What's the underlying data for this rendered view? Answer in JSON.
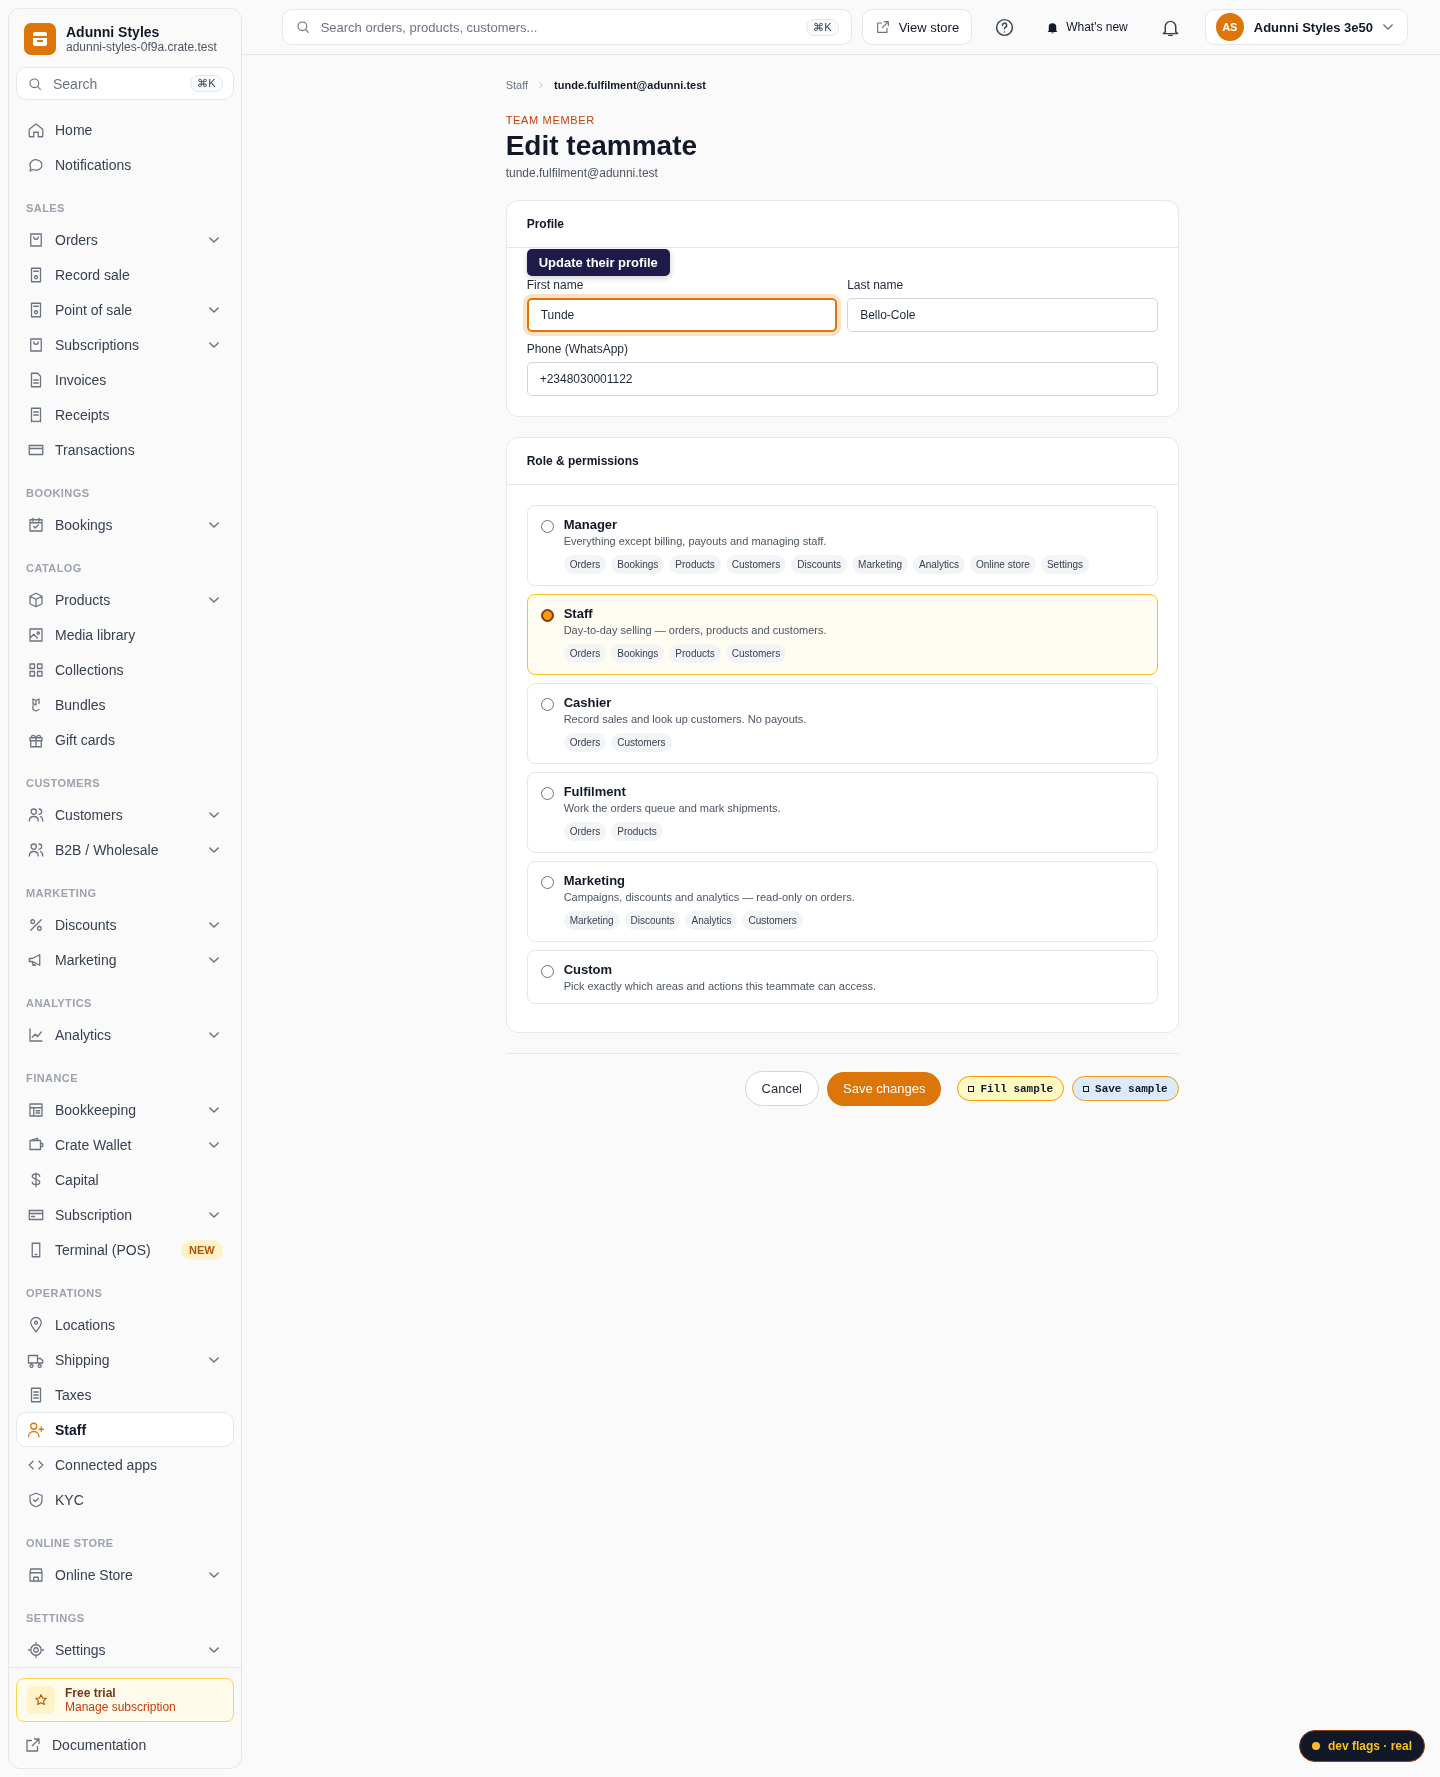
{
  "brand": {
    "name": "Adunni Styles",
    "domain": "adunni-styles-0f9a.crate.test"
  },
  "sidebar_search": {
    "placeholder": "Search",
    "shortcut": "⌘K"
  },
  "sidebar": {
    "sections": [
      {
        "items": [
          {
            "label": "Home",
            "expandable": false,
            "selected": false
          },
          {
            "label": "Notifications",
            "expandable": false,
            "selected": false
          }
        ]
      },
      {
        "title": "SALES",
        "items": [
          {
            "label": "Orders",
            "expandable": true,
            "selected": false
          },
          {
            "label": "Record sale",
            "expandable": false,
            "selected": false
          },
          {
            "label": "Point of sale",
            "expandable": true,
            "selected": false
          },
          {
            "label": "Subscriptions",
            "expandable": true,
            "selected": false
          },
          {
            "label": "Invoices",
            "expandable": false,
            "selected": false
          },
          {
            "label": "Receipts",
            "expandable": false,
            "selected": false
          },
          {
            "label": "Transactions",
            "expandable": false,
            "selected": false
          }
        ]
      },
      {
        "title": "BOOKINGS",
        "items": [
          {
            "label": "Bookings",
            "expandable": true,
            "selected": false
          }
        ]
      },
      {
        "title": "CATALOG",
        "items": [
          {
            "label": "Products",
            "expandable": true,
            "selected": false
          },
          {
            "label": "Media library",
            "expandable": false,
            "selected": false
          },
          {
            "label": "Collections",
            "expandable": false,
            "selected": false
          },
          {
            "label": "Bundles",
            "expandable": false,
            "selected": false
          },
          {
            "label": "Gift cards",
            "expandable": false,
            "selected": false
          }
        ]
      },
      {
        "title": "CUSTOMERS",
        "items": [
          {
            "label": "Customers",
            "expandable": true,
            "selected": false
          },
          {
            "label": "B2B / Wholesale",
            "expandable": true,
            "selected": false
          }
        ]
      },
      {
        "title": "MARKETING",
        "items": [
          {
            "label": "Discounts",
            "expandable": true,
            "selected": false
          },
          {
            "label": "Marketing",
            "expandable": true,
            "selected": false
          }
        ]
      },
      {
        "title": "ANALYTICS",
        "items": [
          {
            "label": "Analytics",
            "expandable": true,
            "selected": false
          }
        ]
      },
      {
        "title": "FINANCE",
        "items": [
          {
            "label": "Bookkeeping",
            "expandable": true,
            "selected": false
          },
          {
            "label": "Crate Wallet",
            "expandable": true,
            "selected": false
          },
          {
            "label": "Capital",
            "expandable": false,
            "selected": false
          },
          {
            "label": "Subscription",
            "expandable": true,
            "selected": false
          },
          {
            "label": "Terminal (POS)",
            "expandable": false,
            "selected": false,
            "badge": "NEW"
          }
        ]
      },
      {
        "title": "OPERATIONS",
        "items": [
          {
            "label": "Locations",
            "expandable": false,
            "selected": false
          },
          {
            "label": "Shipping",
            "expandable": true,
            "selected": false
          },
          {
            "label": "Taxes",
            "expandable": false,
            "selected": false
          },
          {
            "label": "Staff",
            "expandable": false,
            "selected": true
          },
          {
            "label": "Connected apps",
            "expandable": false,
            "selected": false
          },
          {
            "label": "KYC",
            "expandable": false,
            "selected": false
          }
        ]
      },
      {
        "title": "ONLINE STORE",
        "items": [
          {
            "label": "Online Store",
            "expandable": true,
            "selected": false
          }
        ]
      },
      {
        "title": "SETTINGS",
        "items": [
          {
            "label": "Settings",
            "expandable": true,
            "selected": false
          }
        ]
      }
    ]
  },
  "trial": {
    "title": "Free trial",
    "link": "Manage subscription"
  },
  "documentation": "Documentation",
  "topbar": {
    "search_placeholder": "Search orders, products, customers...",
    "shortcut": "⌘K",
    "view_store": "View store",
    "whats_new": "What's new",
    "account": {
      "initials": "AS",
      "name": "Adunni Styles 3e50"
    }
  },
  "breadcrumb": [
    {
      "label": "Staff"
    },
    {
      "label": "tunde.fulfilment@adunni.test"
    }
  ],
  "eyebrow": "TEAM MEMBER",
  "title": "Edit teammate",
  "subtitle": "tunde.fulfilment@adunni.test",
  "profile": {
    "title": "Profile",
    "tooltip": "Update their profile",
    "fields": [
      {
        "label": "First name",
        "value": "Tunde",
        "focused": true
      },
      {
        "label": "Last name",
        "value": "Bello-Cole",
        "focused": false
      },
      {
        "label": "Phone (WhatsApp)",
        "value": "+2348030001122",
        "focused": false
      }
    ]
  },
  "roles": {
    "title": "Role & permissions",
    "options": [
      {
        "name": "Manager",
        "description": "Everything except billing, payouts and managing staff.",
        "selected": false,
        "tags": [
          "Orders",
          "Bookings",
          "Products",
          "Customers",
          "Discounts",
          "Marketing",
          "Analytics",
          "Online store",
          "Settings"
        ]
      },
      {
        "name": "Staff",
        "description": "Day-to-day selling — orders, products and customers.",
        "selected": true,
        "tags": [
          "Orders",
          "Bookings",
          "Products",
          "Customers"
        ]
      },
      {
        "name": "Cashier",
        "description": "Record sales and look up customers. No payouts.",
        "selected": false,
        "tags": [
          "Orders",
          "Customers"
        ]
      },
      {
        "name": "Fulfilment",
        "description": "Work the orders queue and mark shipments.",
        "selected": false,
        "tags": [
          "Orders",
          "Products"
        ]
      },
      {
        "name": "Marketing",
        "description": "Campaigns, discounts and analytics — read-only on orders.",
        "selected": false,
        "tags": [
          "Marketing",
          "Discounts",
          "Analytics",
          "Customers"
        ]
      },
      {
        "name": "Custom",
        "description": "Pick exactly which areas and actions this teammate can access.",
        "selected": false
      }
    ]
  },
  "actions": {
    "cancel": "Cancel",
    "save": "Save changes",
    "fill_sample": "Fill sample",
    "save_sample": "Save sample"
  },
  "dev_flags": "dev flags · real"
}
